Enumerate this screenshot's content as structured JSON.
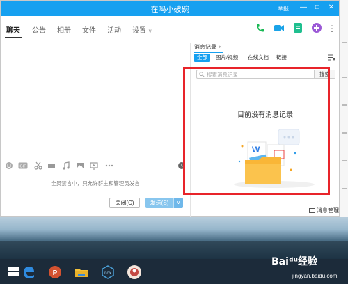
{
  "window": {
    "title": "在吗小破碗",
    "title_link": "举报"
  },
  "nav": {
    "tabs": [
      {
        "label": "聊天",
        "active": true
      },
      {
        "label": "公告"
      },
      {
        "label": "相册"
      },
      {
        "label": "文件"
      },
      {
        "label": "活动"
      },
      {
        "label": "设置"
      }
    ],
    "settings_arrow": "∨"
  },
  "chat": {
    "muted_tip": "全员禁言中，只允许群主和管理员发言",
    "close_button": "关闭(C)",
    "send_button": "发送(S)",
    "send_menu_arrow": "∨"
  },
  "panel": {
    "tab_label": "消息记录",
    "tab_close": "×",
    "filters": [
      "全部",
      "图片/视频",
      "在线文档",
      "链接"
    ],
    "search_placeholder": "搜索消息记录",
    "search_button": "搜索",
    "empty_text": "目前没有消息记录",
    "manage_label": "消息管理"
  },
  "watermark": {
    "brand": "Baiᵈᵘ经验",
    "url": "jingyan.baidu.com"
  },
  "colors": {
    "accent": "#16a0f0",
    "highlight": "#e8242a",
    "call_icon": "#19b955",
    "video_icon": "#1aa3e8",
    "whiteboard_icon": "#1fbf8f",
    "add_icon": "#9b59d6"
  }
}
